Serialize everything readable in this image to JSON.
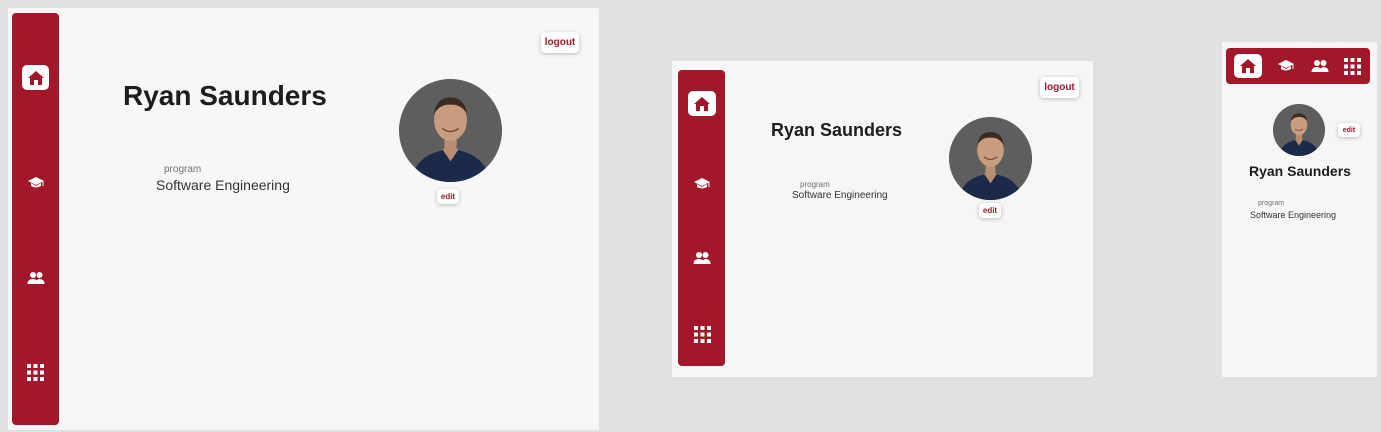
{
  "profile": {
    "name": "Ryan Saunders",
    "program_label": "program",
    "program_value": "Software Engineering"
  },
  "actions": {
    "logout_label": "logout",
    "edit_label": "edit"
  },
  "nav": {
    "items": [
      {
        "id": "home",
        "icon": "home-icon",
        "active": true
      },
      {
        "id": "education",
        "icon": "graduation-cap-icon",
        "active": false
      },
      {
        "id": "people",
        "icon": "people-icon",
        "active": false
      },
      {
        "id": "apps",
        "icon": "grid-icon",
        "active": false
      }
    ]
  },
  "colors": {
    "accent": "#a2172a",
    "background": "#e1e1e1",
    "panel": "#f7f7f7"
  }
}
